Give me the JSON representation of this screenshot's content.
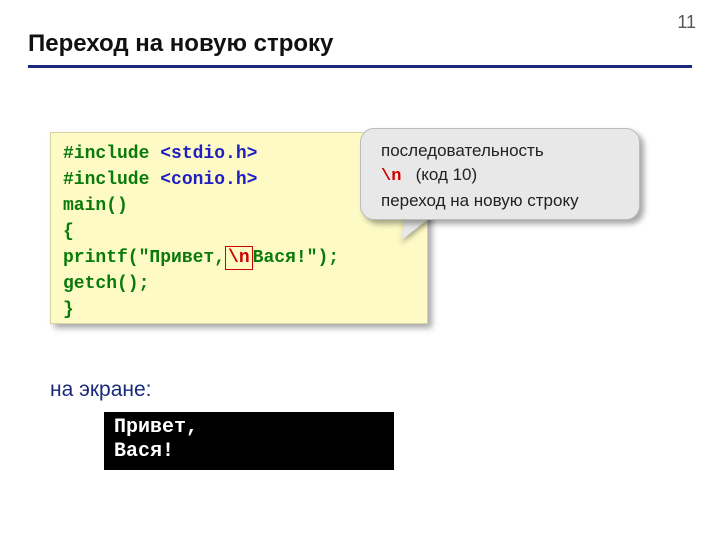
{
  "page_number": "11",
  "title": "Переход на новую строку",
  "code": {
    "line1a": "#include ",
    "line1b": "<stdio.h>",
    "line2a": "#include ",
    "line2b": "<conio.h>",
    "line3": "main()",
    "line4": "{",
    "line5a": "printf(\"Привет,",
    "escape": "\\n",
    "line5b": "Вася!\");",
    "line6": "getch();",
    "line7": "}"
  },
  "callout": {
    "line1": "последовательность",
    "escape": "\\n",
    "code_info": "(код 10)",
    "line3": "переход на новую строку"
  },
  "screen_label": "на экране:",
  "output": "Привет,\nВася!"
}
